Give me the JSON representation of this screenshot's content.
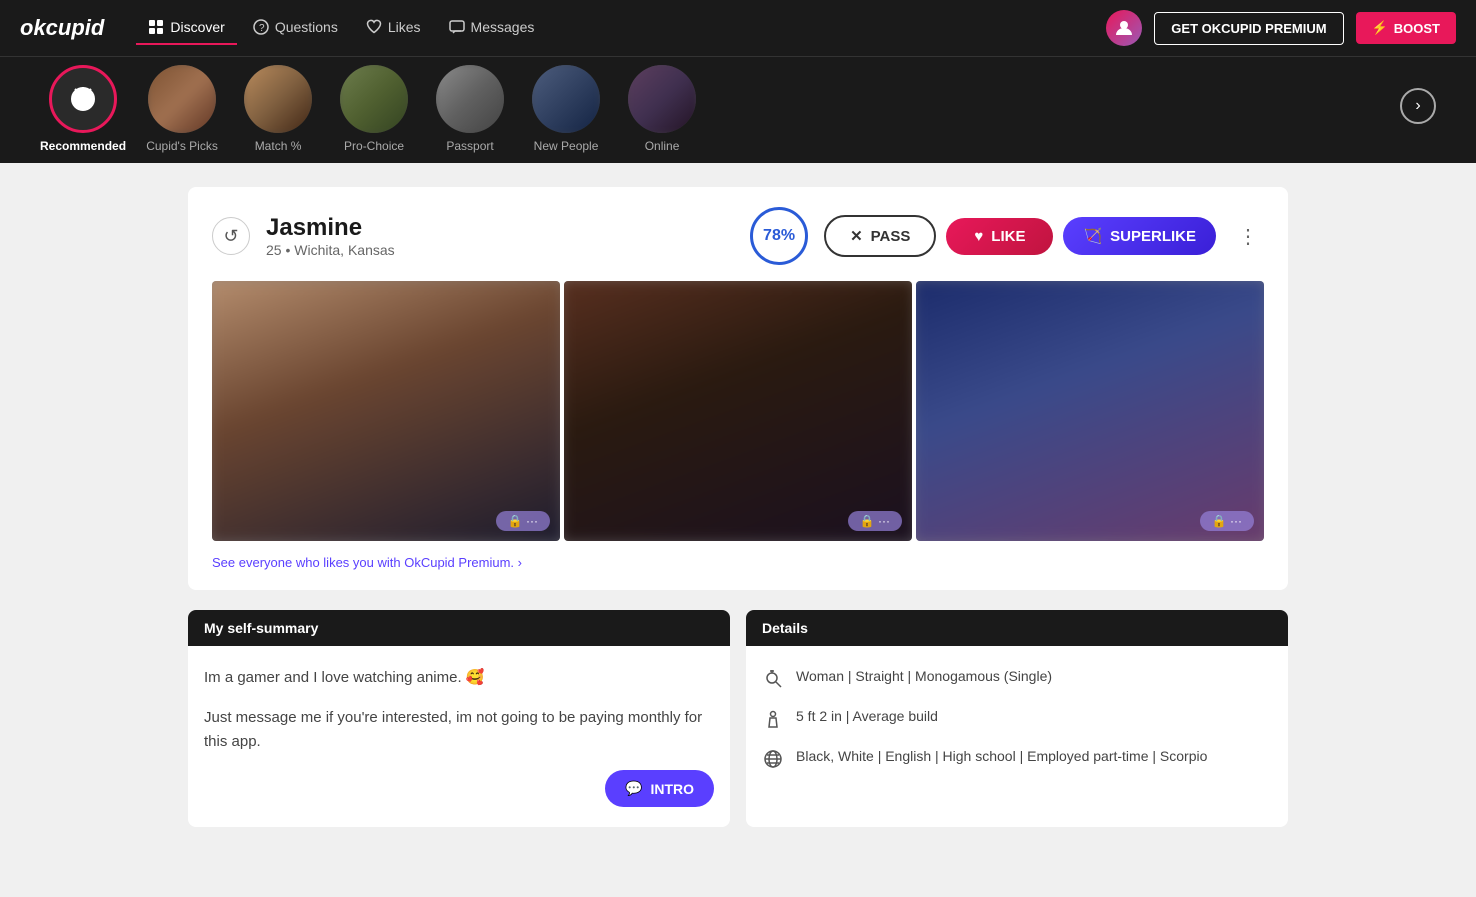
{
  "brand": {
    "logo": "okcupid"
  },
  "navbar": {
    "links": [
      {
        "id": "discover",
        "label": "Discover",
        "active": true
      },
      {
        "id": "questions",
        "label": "Questions",
        "active": false
      },
      {
        "id": "likes",
        "label": "Likes",
        "active": false
      },
      {
        "id": "messages",
        "label": "Messages",
        "active": false
      }
    ],
    "btn_premium": "GET OKCUPID PREMIUM",
    "btn_boost": "⚡ BOOST"
  },
  "categories": [
    {
      "id": "recommended",
      "label": "Recommended",
      "active": true,
      "icon_type": "svg"
    },
    {
      "id": "cupids_picks",
      "label": "Cupid's Picks",
      "active": false,
      "icon_type": "photo"
    },
    {
      "id": "match",
      "label": "Match %",
      "active": false,
      "icon_type": "photo"
    },
    {
      "id": "pro_choice",
      "label": "Pro-Choice",
      "active": false,
      "icon_type": "photo"
    },
    {
      "id": "passport",
      "label": "Passport",
      "active": false,
      "icon_type": "photo"
    },
    {
      "id": "new_people",
      "label": "New People",
      "active": false,
      "icon_type": "photo"
    },
    {
      "id": "online",
      "label": "Online",
      "active": false,
      "icon_type": "photo"
    }
  ],
  "profile": {
    "name": "Jasmine",
    "age": "25",
    "location": "Wichita, Kansas",
    "match_percent": "78%",
    "btn_pass": "PASS",
    "btn_like": "LIKE",
    "btn_superlike": "SUPERLIKE",
    "premium_prompt": "See everyone who likes you with OkCupid Premium. ›",
    "self_summary_header": "My self-summary",
    "self_summary_line1": "Im a gamer and I love watching anime. 🥰",
    "self_summary_line2": "Just message me if you're interested, im not going to be paying monthly for this app.",
    "btn_intro": "INTRO",
    "details_header": "Details",
    "details": [
      {
        "icon": "gender",
        "text": "Woman | Straight | Monogamous (Single)"
      },
      {
        "icon": "height",
        "text": "5 ft 2 in | Average build"
      },
      {
        "icon": "globe",
        "text": "Black, White | English | High school | Employed part-time | Scorpio"
      }
    ]
  }
}
